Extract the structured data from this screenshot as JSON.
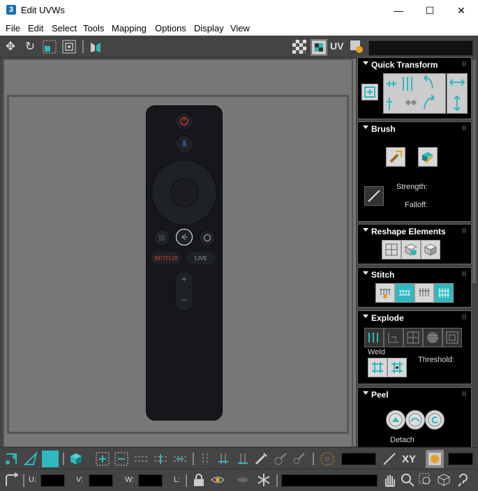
{
  "window": {
    "app_icon": "3",
    "title": "Edit UVWs",
    "minimize": "—",
    "maximize": "☐",
    "close": "✕"
  },
  "menu": [
    "File",
    "Edit",
    "Select",
    "Tools",
    "Mapping",
    "Options",
    "Display",
    "View"
  ],
  "toolbar": {
    "uv_label": "UV"
  },
  "remote": {
    "netflix": "NETFLIX",
    "live": "LIVE",
    "plus": "+",
    "minus": "−"
  },
  "panel": {
    "quick_transform": "Quick Transform",
    "brush": "Brush",
    "strength": "Strength:",
    "falloff": "Falloff:",
    "reshape": "Reshape Elements",
    "stitch": "Stitch",
    "explode": "Explode",
    "weld": "Weld",
    "threshold": "Threshold:",
    "peel": "Peel",
    "detach": "Detach"
  },
  "bottom": {
    "xy_label": "XY",
    "u_label": "U:",
    "v_label": "V:",
    "w_label": "W:",
    "l_label": "L:"
  },
  "colors": {
    "accent": "#2fb8c0",
    "viewport_bg": "#777777",
    "panel_bg": "#000000",
    "ui_bg": "#444444"
  }
}
